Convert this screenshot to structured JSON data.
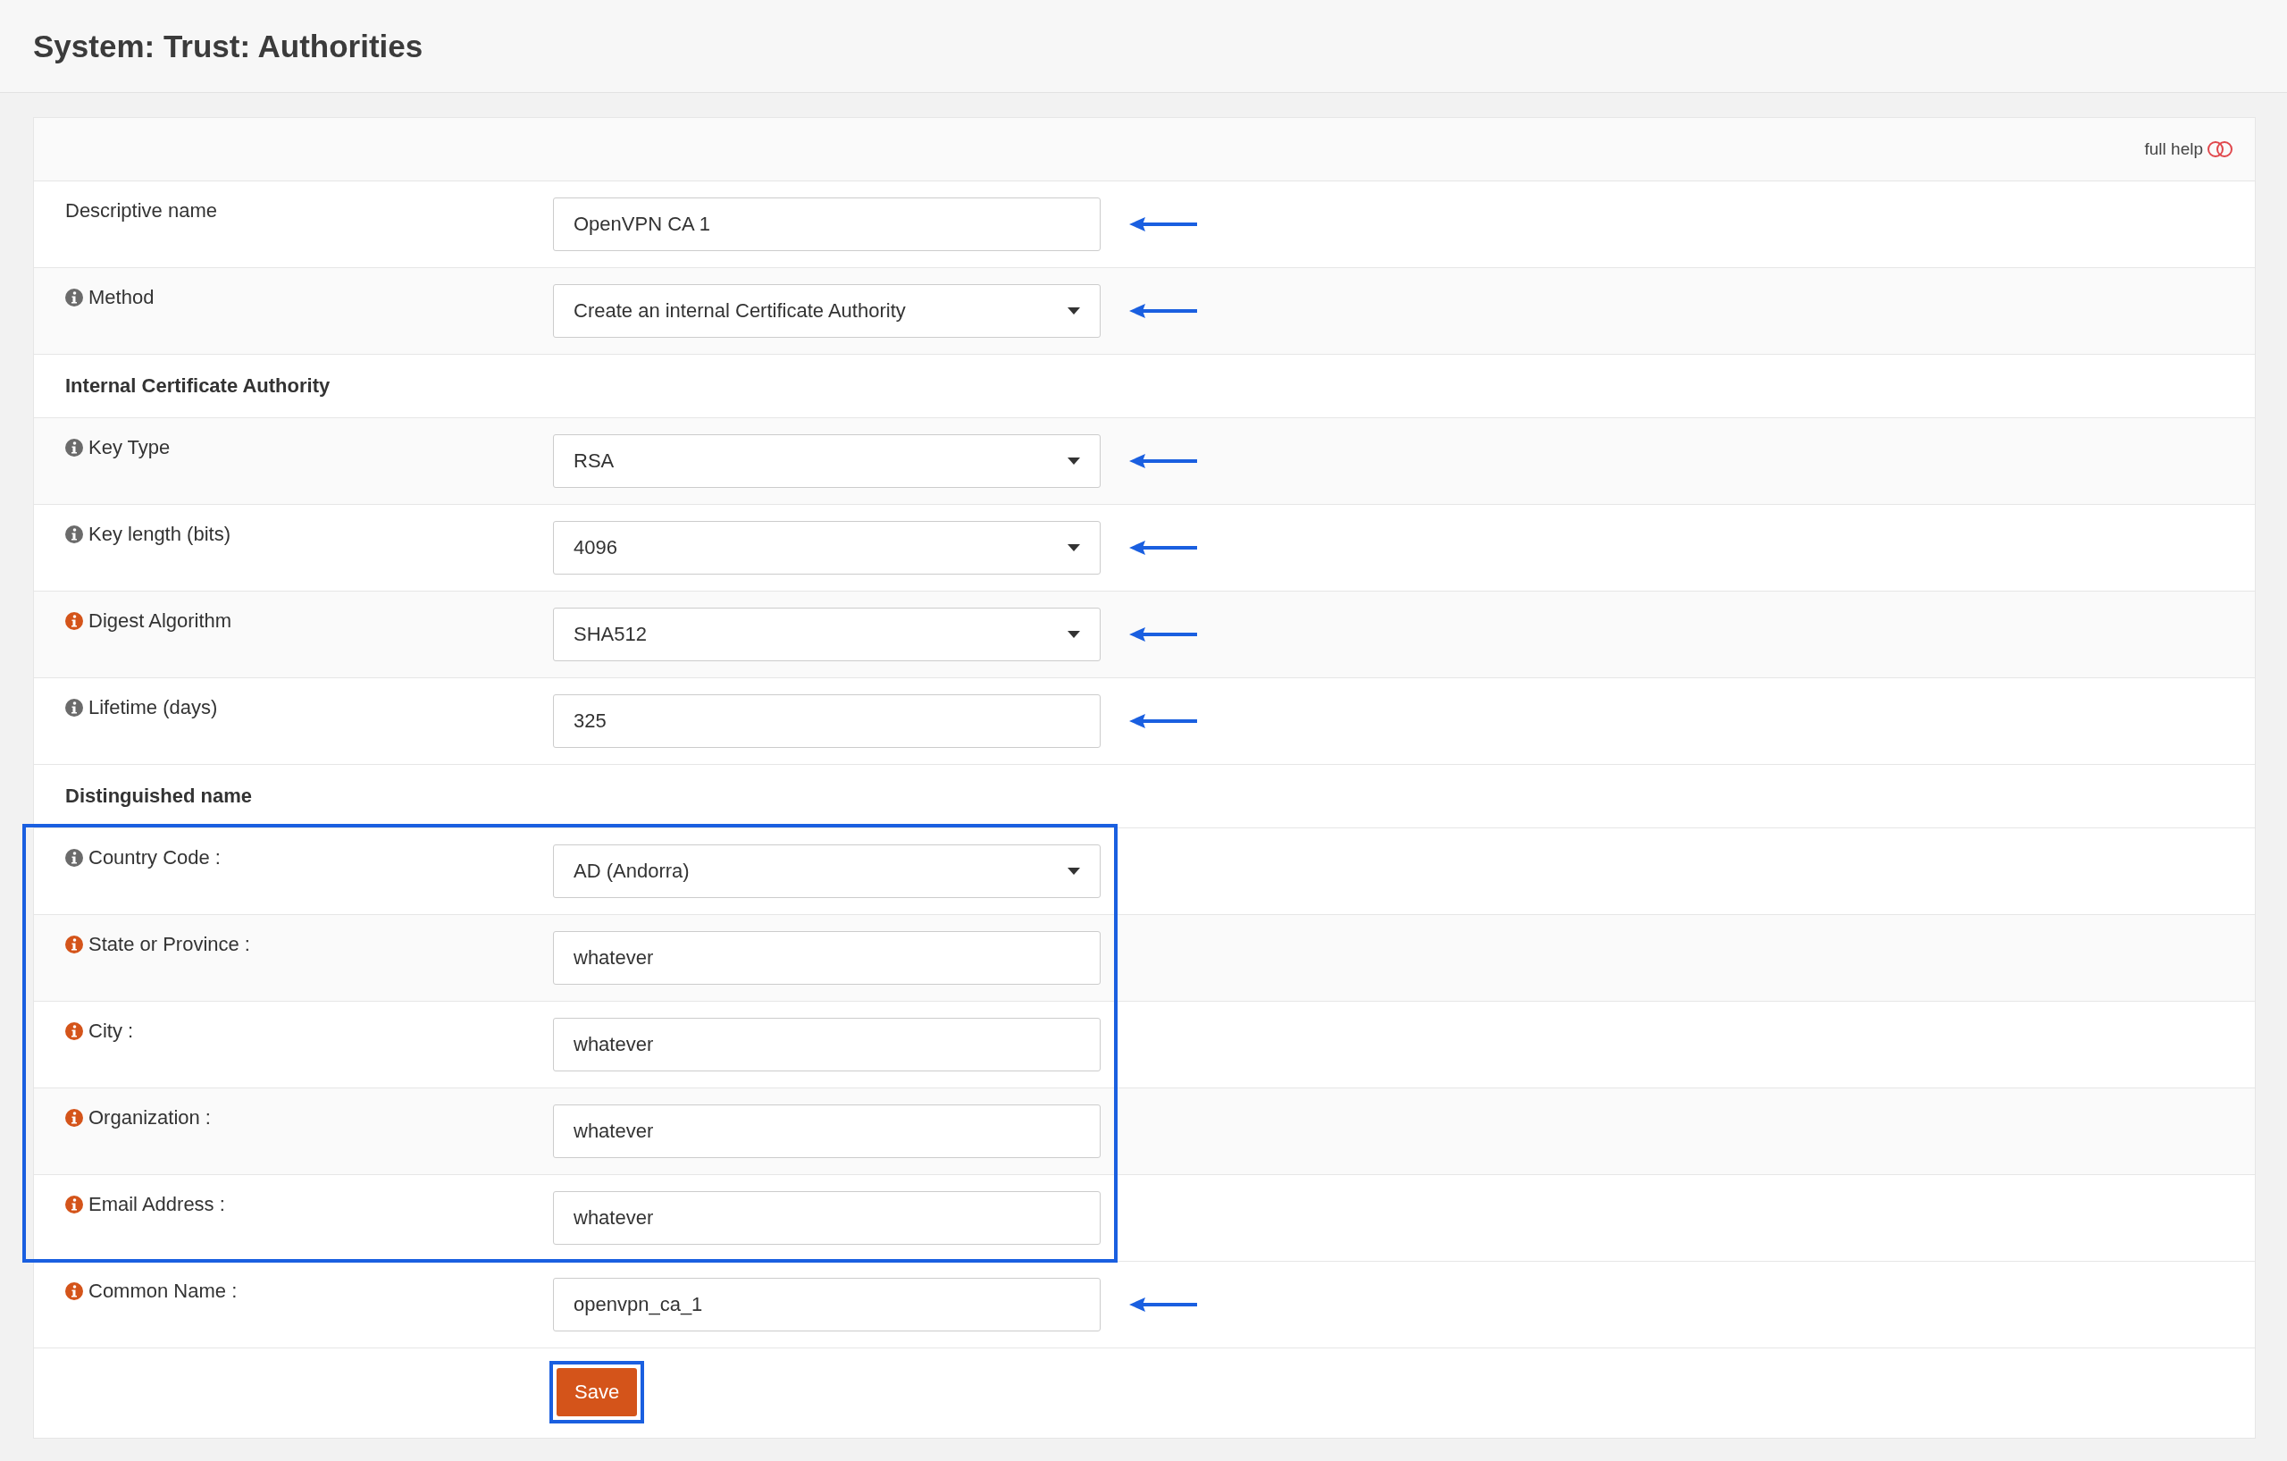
{
  "page_title": "System: Trust: Authorities",
  "full_help": {
    "label": "full help",
    "on": false
  },
  "groups": [
    {
      "highlighted": false,
      "rows": [
        {
          "kind": "text",
          "label": "Descriptive name",
          "value": "OpenVPN CA 1",
          "annotated": true
        },
        {
          "kind": "select",
          "label": "Method",
          "color": "#6b6b6b",
          "value": "Create an internal Certificate Authority",
          "annotated": true
        },
        {
          "kind": "heading",
          "label": "Internal Certificate Authority"
        },
        {
          "kind": "select",
          "label": "Key Type",
          "color": "#6b6b6b",
          "value": "RSA",
          "annotated": true
        },
        {
          "kind": "select",
          "label": "Key length (bits)",
          "color": "#6b6b6b",
          "value": "4096",
          "annotated": true
        },
        {
          "kind": "select",
          "label": "Digest Algorithm",
          "color": "#d4541a",
          "value": "SHA512",
          "annotated": true
        },
        {
          "kind": "text",
          "label": "Lifetime (days)",
          "color": "#6b6b6b",
          "value": "325",
          "annotated": true
        },
        {
          "kind": "heading",
          "label": "Distinguished name"
        }
      ]
    },
    {
      "highlighted": true,
      "rows": [
        {
          "kind": "select",
          "label": "Country Code :",
          "color": "#6b6b6b",
          "value": "AD (Andorra)",
          "annotated": false
        },
        {
          "kind": "text",
          "label": "State or Province :",
          "color": "#d4541a",
          "value": "whatever",
          "annotated": false
        },
        {
          "kind": "text",
          "label": "City :",
          "color": "#d4541a",
          "value": "whatever",
          "annotated": false
        },
        {
          "kind": "text",
          "label": "Organization :",
          "color": "#d4541a",
          "value": "whatever",
          "annotated": false
        },
        {
          "kind": "text",
          "label": "Email Address :",
          "color": "#d4541a",
          "value": "whatever",
          "annotated": false
        }
      ]
    },
    {
      "highlighted": false,
      "rows": [
        {
          "kind": "text",
          "label": "Common Name :",
          "color": "#d4541a",
          "value": "openvpn_ca_1",
          "annotated": true
        }
      ]
    }
  ],
  "save_button": {
    "label": "Save",
    "highlighted": true
  }
}
